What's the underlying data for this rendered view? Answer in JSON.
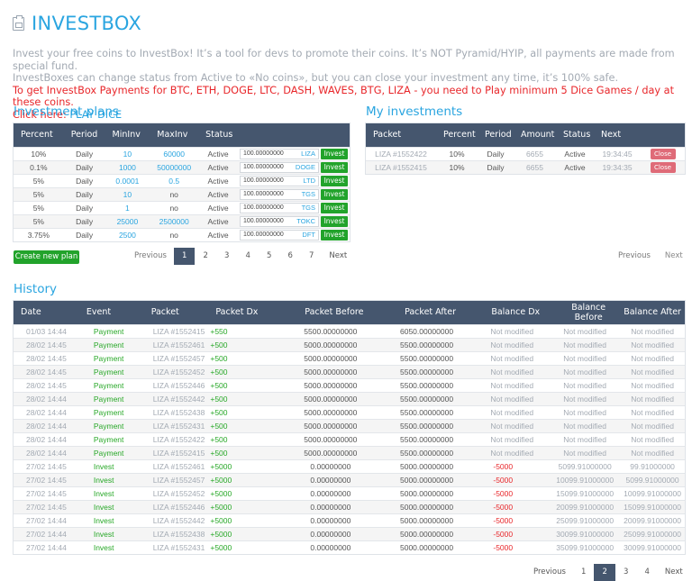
{
  "header": {
    "title": "INVESTBOX",
    "icon": "clipboard-icon"
  },
  "intro": {
    "line1": "Invest your free coins to InvestBox! It’s a tool for devs to promote their coins. It’s NOT Pyramid/HYIP, all payments are made from special fund.",
    "line2": "InvestBoxes can change status from Active to «No coins», but you can close your investment any time, it’s 100% safe.",
    "warning": "To get InvestBox Payments for BTC, ETH, DOGE, LTC, DASH, WAVES, BTG, LIZA - you need to Play minimum 5 Dice Games / day at these coins.",
    "click_here": "Click here: ",
    "play_dice": "PLAY DICE"
  },
  "plans": {
    "title": "Investment plans",
    "columns": [
      "Percent",
      "Period",
      "MinInv",
      "MaxInv",
      "Status",
      ""
    ],
    "invest_label": "Invest",
    "rows": [
      {
        "percent": "10%",
        "period": "Daily",
        "min": "10",
        "max": "60000",
        "status": "Active",
        "amount": "100.00000000",
        "coin": "LIZA"
      },
      {
        "percent": "0.1%",
        "period": "Daily",
        "min": "1000",
        "max": "50000000",
        "status": "Active",
        "amount": "100.00000000",
        "coin": "DOGE"
      },
      {
        "percent": "5%",
        "period": "Daily",
        "min": "0.0001",
        "max": "0.5",
        "status": "Active",
        "amount": "100.00000000",
        "coin": "LTD"
      },
      {
        "percent": "5%",
        "period": "Daily",
        "min": "10",
        "max": "no",
        "status": "Active",
        "amount": "100.00000000",
        "coin": "TGS"
      },
      {
        "percent": "5%",
        "period": "Daily",
        "min": "1",
        "max": "no",
        "status": "Active",
        "amount": "100.00000000",
        "coin": "TGS"
      },
      {
        "percent": "5%",
        "period": "Daily",
        "min": "25000",
        "max": "2500000",
        "status": "Active",
        "amount": "100.00000000",
        "coin": "TOKC"
      },
      {
        "percent": "3.75%",
        "period": "Daily",
        "min": "2500",
        "max": "no",
        "status": "Active",
        "amount": "100.00000000",
        "coin": "DFT"
      }
    ],
    "create_label": "Create new plan",
    "pager": {
      "prev": "Previous",
      "pages": [
        "1",
        "2",
        "3",
        "4",
        "5",
        "6",
        "7"
      ],
      "active": "1",
      "next": "Next"
    }
  },
  "my_investments": {
    "title": "My investments",
    "columns": [
      "Packet",
      "Percent",
      "Period",
      "Amount",
      "Status",
      "Next",
      ""
    ],
    "close_label": "Close",
    "rows": [
      {
        "packet": "LIZA #1552422",
        "percent": "10%",
        "period": "Daily",
        "amount": "6655",
        "status": "Active",
        "next": "19:34:45"
      },
      {
        "packet": "LIZA #1552415",
        "percent": "10%",
        "period": "Daily",
        "amount": "6655",
        "status": "Active",
        "next": "19:34:35"
      }
    ],
    "pager": {
      "prev": "Previous",
      "next": "Next"
    }
  },
  "history": {
    "title": "History",
    "columns": [
      "Date",
      "Event",
      "Packet",
      "Packet Dx",
      "Packet Before",
      "Packet After",
      "Balance Dx",
      "Balance Before",
      "Balance After"
    ],
    "rows": [
      {
        "date": "01/03 14:44",
        "event": "Payment",
        "packet": "LIZA #1552415",
        "pdx": "+550",
        "pbefore": "5500.00000000",
        "pafter": "6050.00000000",
        "bdx": "Not modified",
        "bbefore": "Not modified",
        "bafter": "Not modified"
      },
      {
        "date": "28/02 14:45",
        "event": "Payment",
        "packet": "LIZA #1552461",
        "pdx": "+500",
        "pbefore": "5000.00000000",
        "pafter": "5500.00000000",
        "bdx": "Not modified",
        "bbefore": "Not modified",
        "bafter": "Not modified"
      },
      {
        "date": "28/02 14:45",
        "event": "Payment",
        "packet": "LIZA #1552457",
        "pdx": "+500",
        "pbefore": "5000.00000000",
        "pafter": "5500.00000000",
        "bdx": "Not modified",
        "bbefore": "Not modified",
        "bafter": "Not modified"
      },
      {
        "date": "28/02 14:45",
        "event": "Payment",
        "packet": "LIZA #1552452",
        "pdx": "+500",
        "pbefore": "5000.00000000",
        "pafter": "5500.00000000",
        "bdx": "Not modified",
        "bbefore": "Not modified",
        "bafter": "Not modified"
      },
      {
        "date": "28/02 14:45",
        "event": "Payment",
        "packet": "LIZA #1552446",
        "pdx": "+500",
        "pbefore": "5000.00000000",
        "pafter": "5500.00000000",
        "bdx": "Not modified",
        "bbefore": "Not modified",
        "bafter": "Not modified"
      },
      {
        "date": "28/02 14:44",
        "event": "Payment",
        "packet": "LIZA #1552442",
        "pdx": "+500",
        "pbefore": "5000.00000000",
        "pafter": "5500.00000000",
        "bdx": "Not modified",
        "bbefore": "Not modified",
        "bafter": "Not modified"
      },
      {
        "date": "28/02 14:44",
        "event": "Payment",
        "packet": "LIZA #1552438",
        "pdx": "+500",
        "pbefore": "5000.00000000",
        "pafter": "5500.00000000",
        "bdx": "Not modified",
        "bbefore": "Not modified",
        "bafter": "Not modified"
      },
      {
        "date": "28/02 14:44",
        "event": "Payment",
        "packet": "LIZA #1552431",
        "pdx": "+500",
        "pbefore": "5000.00000000",
        "pafter": "5500.00000000",
        "bdx": "Not modified",
        "bbefore": "Not modified",
        "bafter": "Not modified"
      },
      {
        "date": "28/02 14:44",
        "event": "Payment",
        "packet": "LIZA #1552422",
        "pdx": "+500",
        "pbefore": "5000.00000000",
        "pafter": "5500.00000000",
        "bdx": "Not modified",
        "bbefore": "Not modified",
        "bafter": "Not modified"
      },
      {
        "date": "28/02 14:44",
        "event": "Payment",
        "packet": "LIZA #1552415",
        "pdx": "+500",
        "pbefore": "5000.00000000",
        "pafter": "5500.00000000",
        "bdx": "Not modified",
        "bbefore": "Not modified",
        "bafter": "Not modified"
      },
      {
        "date": "27/02 14:45",
        "event": "Invest",
        "packet": "LIZA #1552461",
        "pdx": "+5000",
        "pbefore": "0.00000000",
        "pafter": "5000.00000000",
        "bdx": "-5000",
        "bbefore": "5099.91000000",
        "bafter": "99.91000000"
      },
      {
        "date": "27/02 14:45",
        "event": "Invest",
        "packet": "LIZA #1552457",
        "pdx": "+5000",
        "pbefore": "0.00000000",
        "pafter": "5000.00000000",
        "bdx": "-5000",
        "bbefore": "10099.91000000",
        "bafter": "5099.91000000"
      },
      {
        "date": "27/02 14:45",
        "event": "Invest",
        "packet": "LIZA #1552452",
        "pdx": "+5000",
        "pbefore": "0.00000000",
        "pafter": "5000.00000000",
        "bdx": "-5000",
        "bbefore": "15099.91000000",
        "bafter": "10099.91000000"
      },
      {
        "date": "27/02 14:45",
        "event": "Invest",
        "packet": "LIZA #1552446",
        "pdx": "+5000",
        "pbefore": "0.00000000",
        "pafter": "5000.00000000",
        "bdx": "-5000",
        "bbefore": "20099.91000000",
        "bafter": "15099.91000000"
      },
      {
        "date": "27/02 14:44",
        "event": "Invest",
        "packet": "LIZA #1552442",
        "pdx": "+5000",
        "pbefore": "0.00000000",
        "pafter": "5000.00000000",
        "bdx": "-5000",
        "bbefore": "25099.91000000",
        "bafter": "20099.91000000"
      },
      {
        "date": "27/02 14:44",
        "event": "Invest",
        "packet": "LIZA #1552438",
        "pdx": "+5000",
        "pbefore": "0.00000000",
        "pafter": "5000.00000000",
        "bdx": "-5000",
        "bbefore": "30099.91000000",
        "bafter": "25099.91000000"
      },
      {
        "date": "27/02 14:44",
        "event": "Invest",
        "packet": "LIZA #1552431",
        "pdx": "+5000",
        "pbefore": "0.00000000",
        "pafter": "5000.00000000",
        "bdx": "-5000",
        "bbefore": "35099.91000000",
        "bafter": "30099.91000000"
      }
    ],
    "pager": {
      "prev": "Previous",
      "pages": [
        "1",
        "2",
        "3",
        "4"
      ],
      "active": "2",
      "next": "Next"
    }
  },
  "colors": {
    "accent": "#2aa5e0",
    "header_bg": "#45566e",
    "green": "#22a32b",
    "red": "#e8262a",
    "close": "#df6b78"
  }
}
